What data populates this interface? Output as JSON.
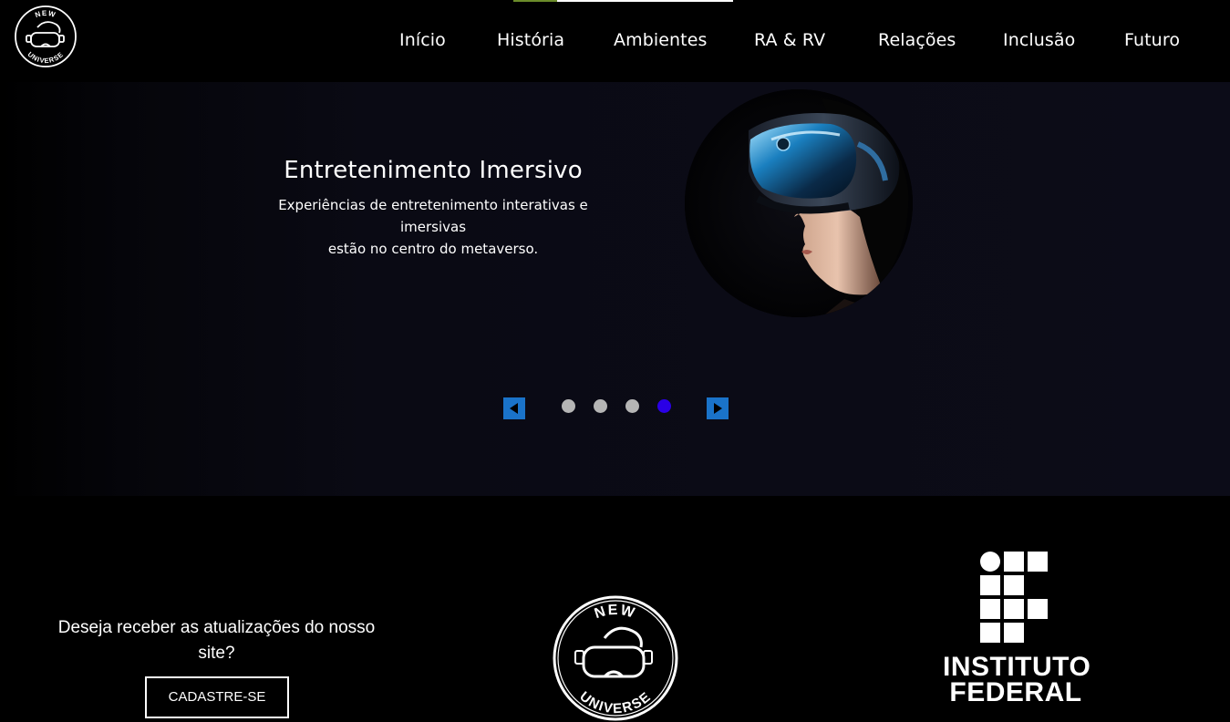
{
  "header": {
    "logo": {
      "top_text": "NEW",
      "bottom_text": "UNIVERSE",
      "icon": "vr-headset-icon"
    },
    "nav": [
      {
        "label": "Início"
      },
      {
        "label": "História"
      },
      {
        "label": "Ambientes"
      },
      {
        "label": "RA & RV"
      },
      {
        "label": "Relações"
      },
      {
        "label": "Inclusão"
      },
      {
        "label": "Futuro"
      }
    ]
  },
  "hero": {
    "title": "Entretenimento Imersivo",
    "description_line1": "Experiências de entretenimento interativas e imersivas",
    "description_line2": "estão no centro do metaverso.",
    "image": "woman-wearing-vr-headset",
    "carousel": {
      "total_slides": 4,
      "active_index": 3,
      "prev_icon": "triangle-left-icon",
      "next_icon": "triangle-right-icon"
    }
  },
  "footer": {
    "newsletter_text": "Deseja receber as atualizações do nosso site?",
    "signup_label": "CADASTRE-SE",
    "logo": {
      "top_text": "NEW",
      "bottom_text": "UNIVERSE"
    },
    "institute_line1": "INSTITUTO",
    "institute_line2": "FEDERAL"
  },
  "colors": {
    "background": "#000000",
    "hero_background": "#0c0c18",
    "arrow_button": "#1a73c9",
    "dot_inactive": "#b5b5b5",
    "dot_active": "#2a00e6"
  }
}
